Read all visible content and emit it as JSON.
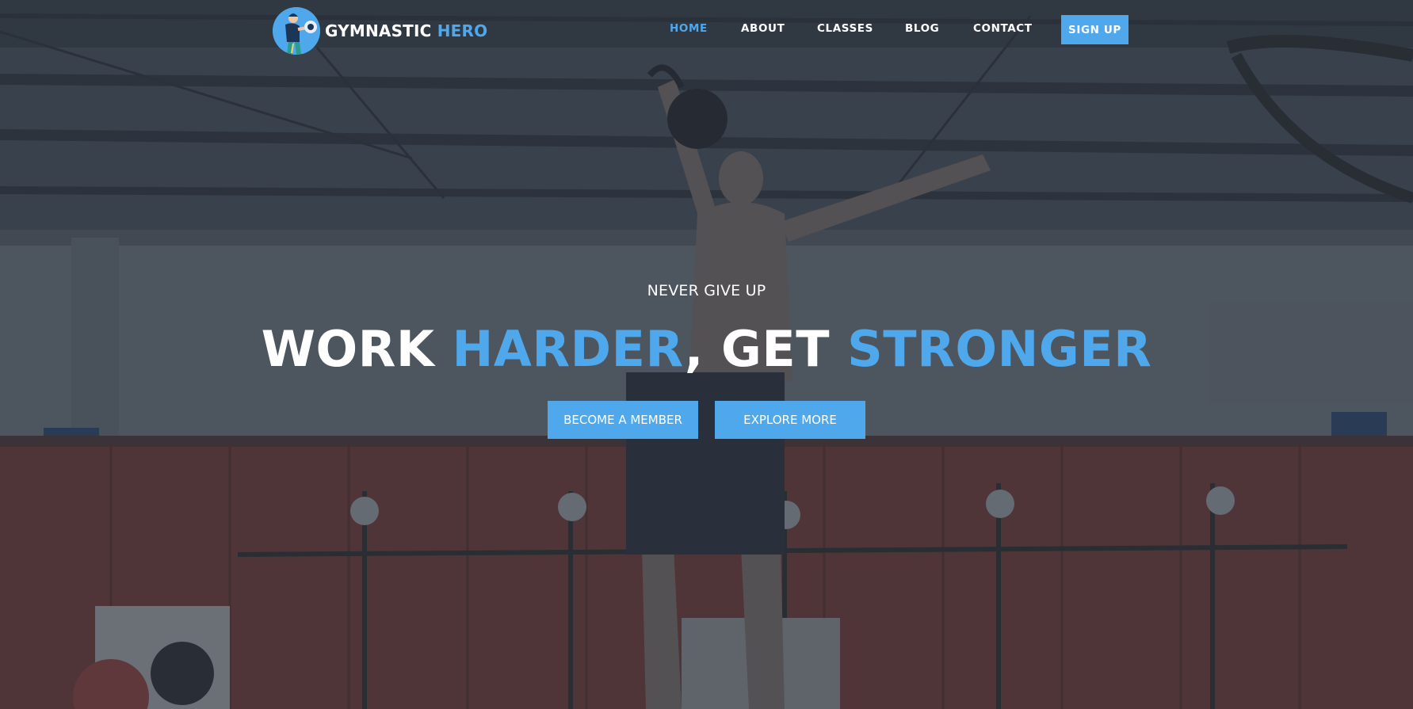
{
  "brand": {
    "name_primary": "GYMNASTIC",
    "name_accent": "HERO",
    "logo_icon": "weightlifter-icon"
  },
  "nav": {
    "items": [
      {
        "label": "HOME",
        "active": true
      },
      {
        "label": "ABOUT",
        "active": false
      },
      {
        "label": "CLASSES",
        "active": false
      },
      {
        "label": "BLOG",
        "active": false
      },
      {
        "label": "CONTACT",
        "active": false
      }
    ],
    "signup_label": "SIGN UP"
  },
  "hero": {
    "tagline": "NEVER GIVE UP",
    "headline": {
      "part1": "WORK ",
      "part2": "HARDER",
      "part3": ", GET ",
      "part4": "STRONGER"
    },
    "buttons": {
      "member": "BECOME A MEMBER",
      "explore": "EXPLORE MORE"
    }
  },
  "colors": {
    "accent": "#4fa8ec",
    "overlay": "#2f3640",
    "text": "#ffffff"
  }
}
